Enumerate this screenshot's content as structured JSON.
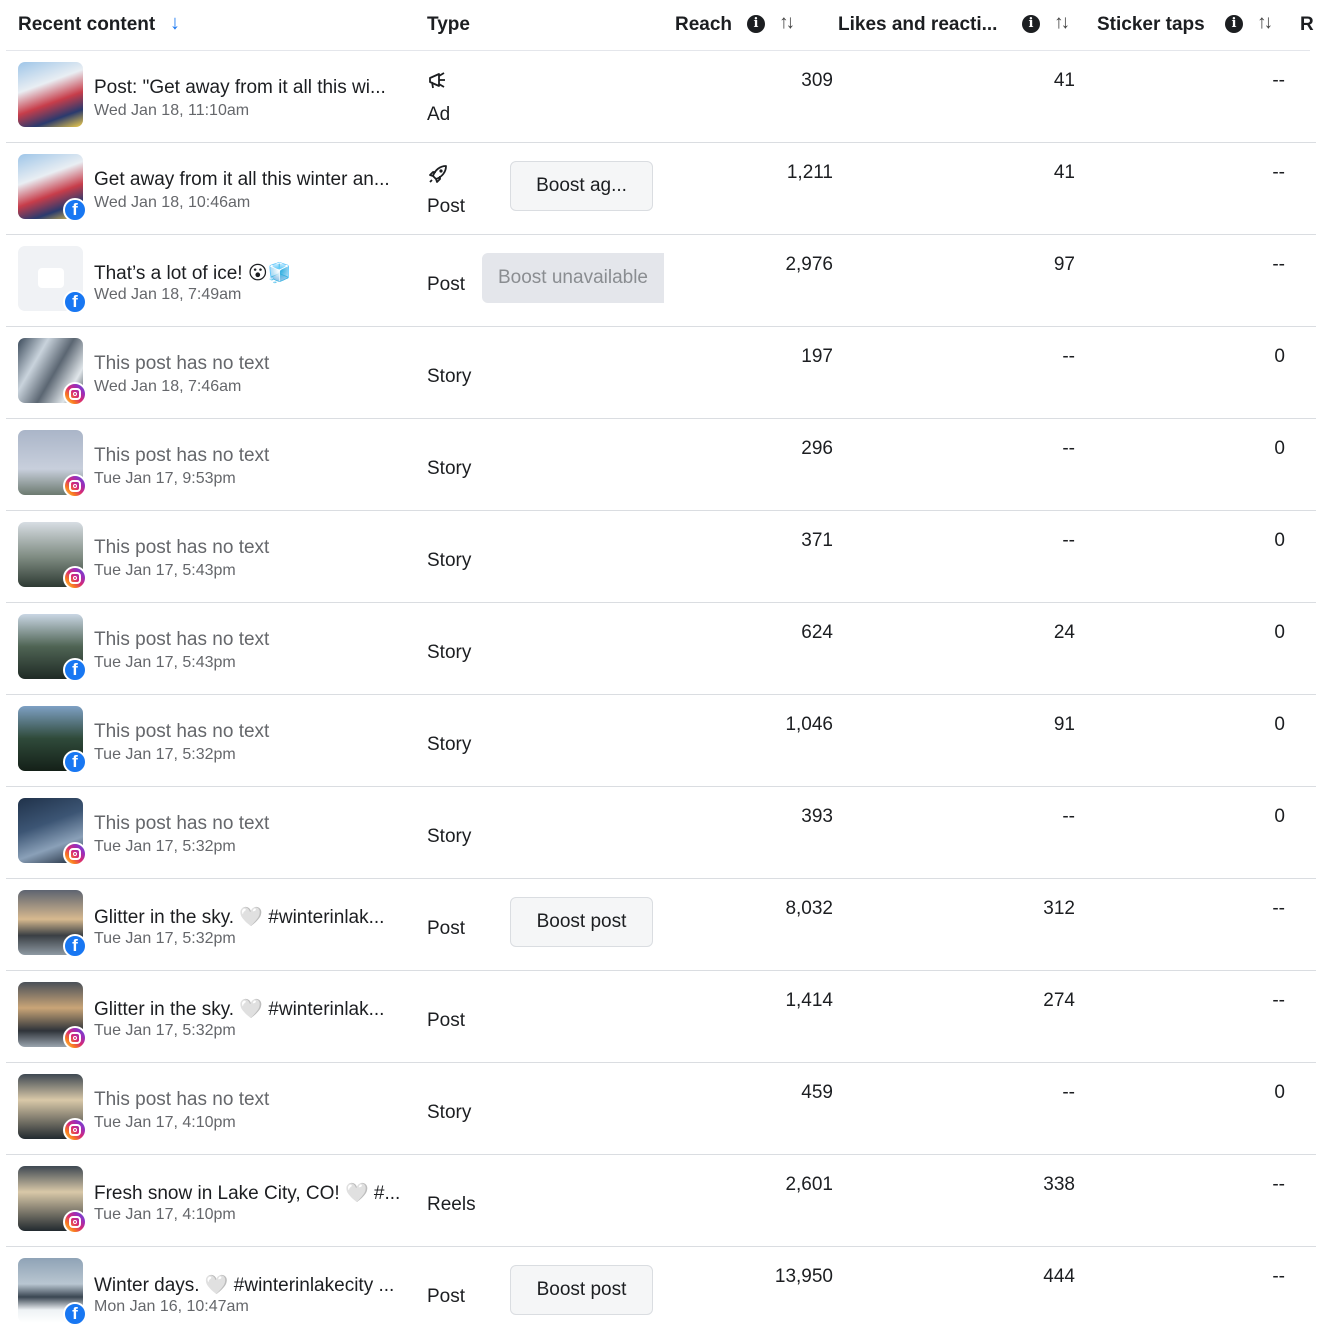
{
  "header": {
    "recent_content": "Recent content",
    "type": "Type",
    "reach": "Reach",
    "likes": "Likes and reacti...",
    "sticker": "Sticker taps",
    "more": "R",
    "sort_arrow": "↓",
    "info_glyph": "i",
    "sort_glyph": "↑↓"
  },
  "rows": [
    {
      "title": "Post: \"Get away from it all this wi...",
      "date": "Wed Jan 18, 11:10am",
      "platform": "none",
      "thumb": "t-ski",
      "type_icon": "megaphone-icon",
      "type": "Ad",
      "boost": "",
      "reach": "309",
      "likes": "41",
      "sticker": "--",
      "muted": false
    },
    {
      "title": "Get away from it all this winter an...",
      "date": "Wed Jan 18, 10:46am",
      "platform": "facebook",
      "thumb": "t-ski",
      "type_icon": "rocket-icon",
      "type": "Post",
      "boost": "Boost ag...",
      "reach": "1,211",
      "likes": "41",
      "sticker": "--",
      "muted": false
    },
    {
      "title": "That’s a lot of ice! 😮🧊",
      "date": "Wed Jan 18, 7:49am",
      "platform": "facebook",
      "thumb": "t-text",
      "type_icon": "",
      "type": "Post",
      "boost": "Boost unavailable",
      "boost_unavailable": true,
      "reach": "2,976",
      "likes": "97",
      "sticker": "--",
      "muted": false
    },
    {
      "title": "This post has no text",
      "date": "Wed Jan 18, 7:46am",
      "platform": "instagram",
      "thumb": "t-ice",
      "type_icon": "",
      "type": "Story",
      "boost": "",
      "reach": "197",
      "likes": "--",
      "sticker": "0",
      "muted": true
    },
    {
      "title": "This post has no text",
      "date": "Tue Jan 17, 9:53pm",
      "platform": "instagram",
      "thumb": "t-wall",
      "type_icon": "",
      "type": "Story",
      "boost": "",
      "reach": "296",
      "likes": "--",
      "sticker": "0",
      "muted": true
    },
    {
      "title": "This post has no text",
      "date": "Tue Jan 17, 5:43pm",
      "platform": "instagram",
      "thumb": "t-trees",
      "type_icon": "",
      "type": "Story",
      "boost": "",
      "reach": "371",
      "likes": "--",
      "sticker": "0",
      "muted": true
    },
    {
      "title": "This post has no text",
      "date": "Tue Jan 17, 5:43pm",
      "platform": "facebook",
      "thumb": "t-pine",
      "type_icon": "",
      "type": "Story",
      "boost": "",
      "reach": "624",
      "likes": "24",
      "sticker": "0",
      "muted": true
    },
    {
      "title": "This post has no text",
      "date": "Tue Jan 17, 5:32pm",
      "platform": "facebook",
      "thumb": "t-forest",
      "type_icon": "",
      "type": "Story",
      "boost": "",
      "reach": "1,046",
      "likes": "91",
      "sticker": "0",
      "muted": true
    },
    {
      "title": "This post has no text",
      "date": "Tue Jan 17, 5:32pm",
      "platform": "instagram",
      "thumb": "t-snowforest",
      "type_icon": "",
      "type": "Story",
      "boost": "",
      "reach": "393",
      "likes": "--",
      "sticker": "0",
      "muted": true
    },
    {
      "title": "Glitter in the sky. 🤍 #winterinlak...",
      "date": "Tue Jan 17, 5:32pm",
      "platform": "facebook",
      "thumb": "t-sunset",
      "type_icon": "",
      "type": "Post",
      "boost": "Boost post",
      "reach": "8,032",
      "likes": "312",
      "sticker": "--",
      "muted": false
    },
    {
      "title": "Glitter in the sky. 🤍 #winterinlak...",
      "date": "Tue Jan 17, 5:32pm",
      "platform": "instagram",
      "thumb": "t-sun2",
      "type_icon": "",
      "type": "Post",
      "boost": "",
      "reach": "1,414",
      "likes": "274",
      "sticker": "--",
      "muted": false
    },
    {
      "title": "This post has no text",
      "date": "Tue Jan 17, 4:10pm",
      "platform": "instagram",
      "thumb": "t-sun3",
      "type_icon": "",
      "type": "Story",
      "boost": "",
      "reach": "459",
      "likes": "--",
      "sticker": "0",
      "muted": true
    },
    {
      "title": "Fresh snow in Lake City, CO! 🤍 #...",
      "date": "Tue Jan 17, 4:10pm",
      "platform": "instagram",
      "thumb": "t-sun3",
      "type_icon": "",
      "type": "Reels",
      "boost": "",
      "reach": "2,601",
      "likes": "338",
      "sticker": "--",
      "muted": false
    },
    {
      "title": "Winter days. 🤍 #winterinlakecity ...",
      "date": "Mon Jan 16, 10:47am",
      "platform": "facebook",
      "thumb": "t-lake",
      "type_icon": "",
      "type": "Post",
      "boost": "Boost post",
      "reach": "13,950",
      "likes": "444",
      "sticker": "--",
      "muted": false
    }
  ]
}
